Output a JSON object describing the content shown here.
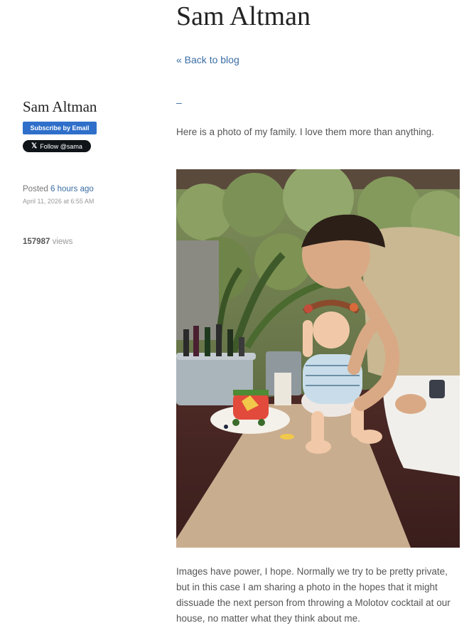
{
  "header": {
    "site_title": "Sam Altman",
    "back_link": "« Back to blog",
    "post_title": "–"
  },
  "sidebar": {
    "author_name": "Sam Altman",
    "subscribe_label": "Subscribe by Email",
    "follow_label": "Follow @sama",
    "posted_prefix": "Posted",
    "posted_relative": "6 hours ago",
    "posted_date": "April 11, 2026 at 6:55 AM",
    "views_count": "157987",
    "views_label": "views"
  },
  "post": {
    "intro": "Here is a photo of my family. I love them more than anything.",
    "body": "Images have power, I hope. Normally we try to be pretty private, but in this case I am sharing a photo in the hopes that it might dissuade the next person from throwing a Molotov cocktail at our house, no matter what they think about me.",
    "photo_icon": "family-photo"
  },
  "colors": {
    "link": "#3a6ea5",
    "subscribe_bg": "#2f6fca",
    "follow_bg": "#0f1419"
  }
}
